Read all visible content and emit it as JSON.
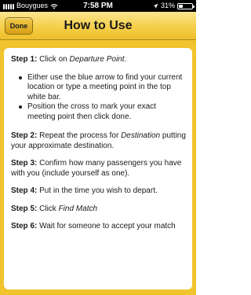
{
  "status_bar": {
    "carrier": "Bouygues",
    "time": "7:58 PM",
    "battery": "31%",
    "battery_level": 0.31
  },
  "nav": {
    "title": "How to Use",
    "done_label": "Done"
  },
  "steps": [
    {
      "label": "Step 1:",
      "pre": " Click on ",
      "em": "Departure Point",
      "post": "."
    },
    {
      "label": "Step 2:",
      "pre": " Repeat the process for ",
      "em": "Destination",
      "post": " putting your approximate destination."
    },
    {
      "label": "Step 3:",
      "pre": " Confirm how many passengers you have with you (include yourself as one).",
      "em": "",
      "post": ""
    },
    {
      "label": "Step 4:",
      "pre": " Put in the time you wish to depart.",
      "em": "",
      "post": ""
    },
    {
      "label": "Step 5:",
      "pre": " Click ",
      "em": "Find Match",
      "post": ""
    },
    {
      "label": "Step 6:",
      "pre": " Wait for someone to accept your match",
      "em": "",
      "post": ""
    }
  ],
  "bullets": [
    "Either use the blue arrow to find your current location or type a meeting point in the top white bar.",
    "Position the cross to mark your exact meeting point then click done."
  ]
}
